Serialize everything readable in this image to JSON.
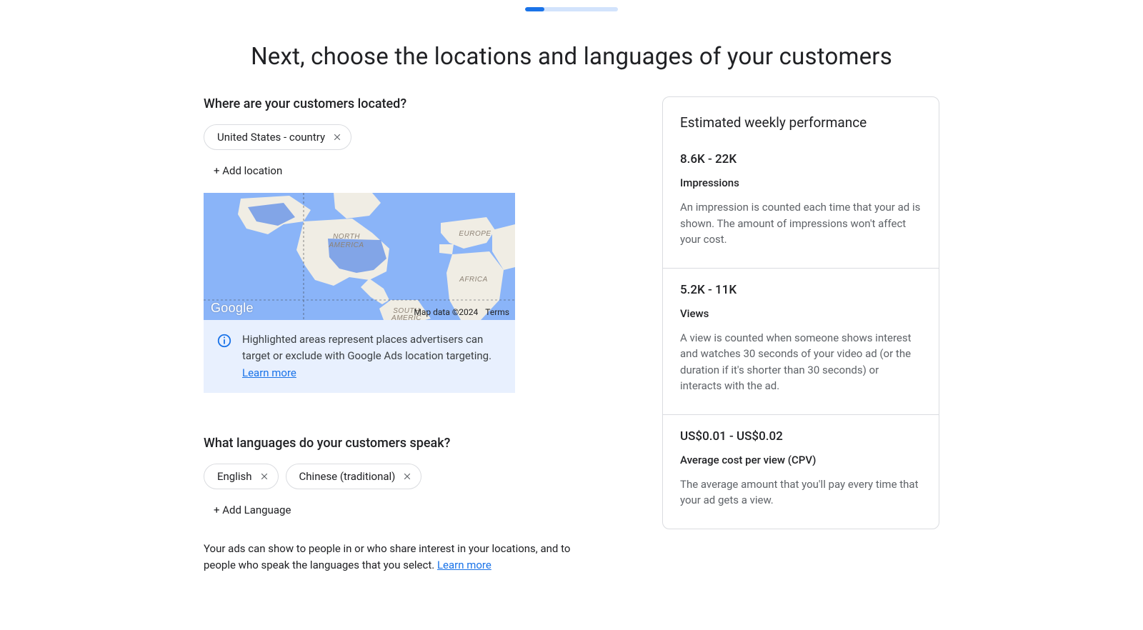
{
  "progress_pct": 21,
  "title": "Next, choose the locations and languages of your customers",
  "locations": {
    "question": "Where are your customers located?",
    "chips": [
      "United States - country"
    ],
    "add_label": "+ Add location",
    "map": {
      "attribution": "Google",
      "map_data": "Map data ©2024",
      "terms": "Terms",
      "continents": {
        "na": "NORTH AMERICA",
        "sa": "SOUTH AMERICA",
        "eu": "EUROPE",
        "af": "AFRICA"
      }
    },
    "info_text": "Highlighted areas represent places advertisers can target or exclude with Google Ads location targeting. ",
    "info_learn_more": "Learn more"
  },
  "languages": {
    "question": "What languages do your customers speak?",
    "chips": [
      "English",
      "Chinese (traditional)"
    ],
    "add_label": "+ Add Language",
    "helper_text": "Your ads can show to people in or who share interest in your locations, and to people who speak the languages that you select. ",
    "helper_learn_more": "Learn more"
  },
  "estimates": {
    "heading": "Estimated weekly performance",
    "metrics": [
      {
        "value": "8.6K - 22K",
        "label": "Impressions",
        "desc": "An impression is counted each time that your ad is shown. The amount of impressions won't affect your cost."
      },
      {
        "value": "5.2K - 11K",
        "label": "Views",
        "desc": "A view is counted when someone shows interest and watches 30 seconds of your video ad (or the duration if it's shorter than 30 seconds) or interacts with the ad."
      },
      {
        "value": "US$0.01 - US$0.02",
        "label": "Average cost per view (CPV)",
        "desc": "The average amount that you'll pay every time that your ad gets a view."
      }
    ]
  }
}
